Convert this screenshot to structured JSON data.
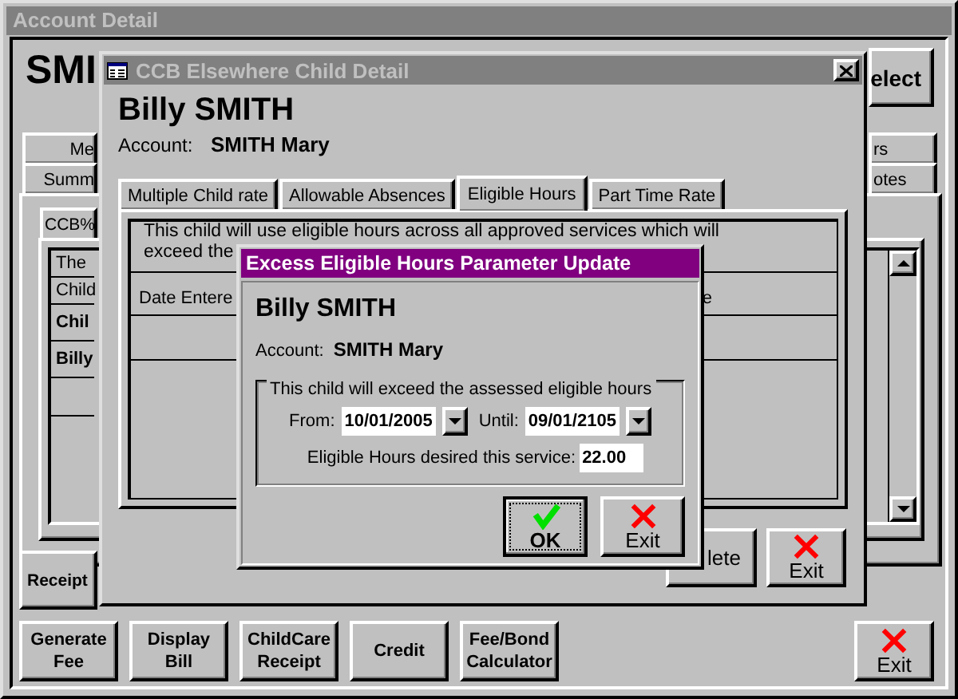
{
  "account_window": {
    "title": "Account Detail",
    "heading": "SMI",
    "select_button": "elect",
    "tabs_left": [
      "Me",
      "Summ"
    ],
    "tabs_right": [
      "rs",
      "otes"
    ],
    "subtab": "CCB%",
    "list_rows": [
      {
        "text": "The",
        "bold": false
      },
      {
        "text": "Child",
        "bold": false
      },
      {
        "text": "Chil",
        "bold": true
      },
      {
        "text": "Billy",
        "bold": true
      }
    ],
    "receipt_button": "Receipt",
    "bottom_buttons": [
      "Generate\nFee",
      "Display\nBill",
      "ChildCare\nReceipt",
      "Credit",
      "Fee/Bond\nCalculator"
    ],
    "exit_button": {
      "label": "Exit",
      "kind": "exit"
    }
  },
  "child_window": {
    "title": "CCB Elsewhere Child Detail",
    "child_name": "Billy SMITH",
    "account_label": "Account:",
    "account_name": "SMITH Mary",
    "tabs": [
      {
        "label": "Multiple Child rate",
        "selected": false
      },
      {
        "label": "Allowable Absences",
        "selected": false
      },
      {
        "label": "Eligible Hours",
        "selected": true
      },
      {
        "label": "Part Time Rate",
        "selected": false
      }
    ],
    "description_lines": [
      "This child will use eligible hours across all approved services which will",
      "exceed the"
    ],
    "columns": [
      "Date Entere",
      "e"
    ],
    "buttons": [
      {
        "label": "lete",
        "kind": "plain"
      },
      {
        "label": "Exit",
        "kind": "exit"
      }
    ]
  },
  "dialog": {
    "title": "Excess Eligible Hours Parameter Update",
    "child_name": "Billy SMITH",
    "account_label": "Account:",
    "account_name": "SMITH Mary",
    "group_label": "This child will exceed the assessed eligible hours",
    "from": {
      "label": "From:",
      "value": "10/01/2005"
    },
    "until": {
      "label": "Until:",
      "value": "09/01/2105"
    },
    "hours": {
      "label": "Eligible Hours desired this service:",
      "value": "22.00"
    },
    "buttons": [
      {
        "label": "OK",
        "kind": "ok",
        "focused": true
      },
      {
        "label": "Exit",
        "kind": "exit",
        "focused": false
      }
    ]
  }
}
